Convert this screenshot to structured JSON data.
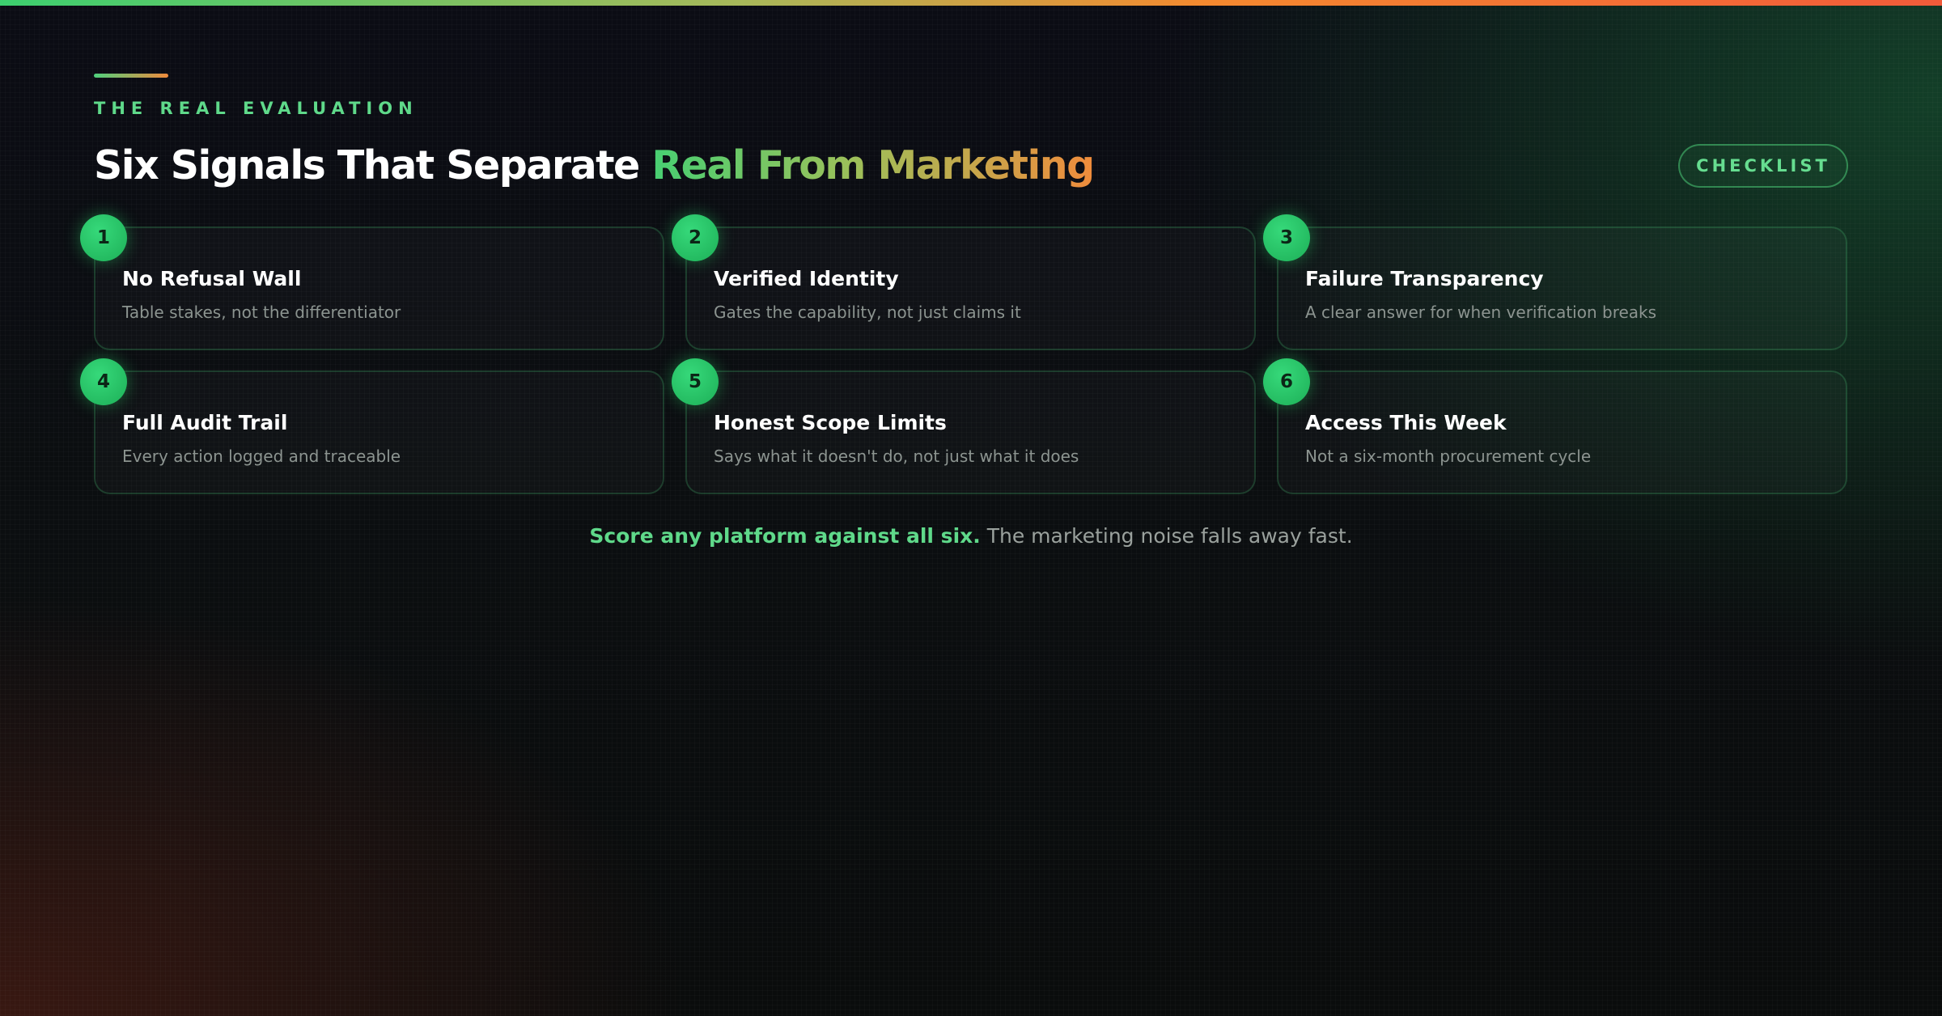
{
  "header": {
    "eyebrow": "THE REAL EVALUATION",
    "title_plain": "Six Signals That Separate ",
    "title_highlight": "Real From Marketing",
    "checklist_label": "CHECKLIST"
  },
  "signals": [
    {
      "number": "1",
      "title": "No Refusal Wall",
      "description": "Table stakes, not the differentiator"
    },
    {
      "number": "2",
      "title": "Verified Identity",
      "description": "Gates the capability, not just claims it"
    },
    {
      "number": "3",
      "title": "Failure Transparency",
      "description": "A clear answer for when verification breaks"
    },
    {
      "number": "4",
      "title": "Full Audit Trail",
      "description": "Every action logged and traceable"
    },
    {
      "number": "5",
      "title": "Honest Scope Limits",
      "description": "Says what it doesn't do, not just what it does"
    },
    {
      "number": "6",
      "title": "Access This Week",
      "description": "Not a six-month procurement cycle"
    }
  ],
  "footer": {
    "strong": "Score any platform against all six.",
    "rest": "The marketing noise falls away fast."
  },
  "colors": {
    "accent_green": "#5fd98a",
    "accent_orange": "#f08c3c",
    "badge_green": "#22c063",
    "background": "#0b0d0f"
  }
}
